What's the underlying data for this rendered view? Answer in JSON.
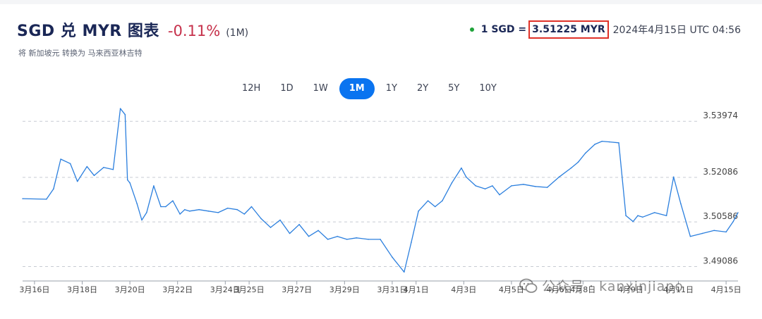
{
  "header": {
    "title": "SGD 兑 MYR 图表",
    "change": "-0.11%",
    "period": "(1M)",
    "subtitle": "将 新加坡元 转换为 马来西亚林吉特"
  },
  "rate": {
    "prefix": "1 SGD =",
    "value": "3.51225 MYR",
    "time": "2024年4月15日 UTC 04:56"
  },
  "tabs": [
    {
      "label": "12H",
      "active": false
    },
    {
      "label": "1D",
      "active": false
    },
    {
      "label": "1W",
      "active": false
    },
    {
      "label": "1M",
      "active": true
    },
    {
      "label": "1Y",
      "active": false
    },
    {
      "label": "2Y",
      "active": false
    },
    {
      "label": "5Y",
      "active": false
    },
    {
      "label": "10Y",
      "active": false
    }
  ],
  "colors": {
    "line": "#2b7fde",
    "accent": "#0a74f0",
    "negative": "#c6314b",
    "highlight": "#e03128"
  },
  "watermark": {
    "text": "公众号 · kanxinjiapo",
    "icon": "wechat-icon"
  },
  "chart_data": {
    "type": "line",
    "title": "",
    "xlabel": "",
    "ylabel": "",
    "ylim": [
      3.486,
      3.545
    ],
    "grid": true,
    "y_ticks": [
      3.53974,
      3.52086,
      3.50586,
      3.49086
    ],
    "y_tick_labels": [
      "3.53974",
      "3.52086",
      "3.50586",
      "3.49086"
    ],
    "x_ticks": [
      0.5,
      2.5,
      4.5,
      6.5,
      8.5,
      9.5,
      11.5,
      13.5,
      15.5,
      16.5,
      18.5,
      20.5,
      22.5,
      23.5,
      25.5,
      27.5,
      29.5
    ],
    "x_tick_labels": [
      "3月16日",
      "3月18日",
      "3月20日",
      "3月22日",
      "3月24日",
      "3月25日",
      "3月27日",
      "3月29日",
      "3月31日",
      "4月1日",
      "4月3日",
      "4月5日",
      "4月6日",
      "4月8日",
      "4月9日",
      "4月11日",
      "4月15日"
    ],
    "x": [
      0.0,
      1.0,
      1.3,
      1.6,
      2.0,
      2.3,
      2.7,
      3.0,
      3.4,
      3.8,
      4.1,
      4.3,
      4.4,
      4.5,
      4.8,
      5.0,
      5.2,
      5.5,
      5.8,
      6.0,
      6.3,
      6.6,
      6.8,
      7.0,
      7.4,
      7.8,
      8.2,
      8.6,
      9.0,
      9.3,
      9.6,
      10.0,
      10.4,
      10.8,
      11.2,
      11.6,
      12.0,
      12.4,
      12.8,
      13.2,
      13.6,
      14.0,
      14.5,
      15.0,
      15.5,
      16.0,
      16.3,
      16.6,
      17.0,
      17.3,
      17.6,
      18.0,
      18.4,
      18.6,
      19.0,
      19.4,
      19.7,
      20.0,
      20.5,
      21.0,
      21.5,
      22.0,
      22.5,
      23.0,
      23.3,
      23.6,
      24.0,
      24.3,
      24.6,
      25.0,
      25.3,
      25.6,
      25.8,
      26.0,
      26.5,
      27.0,
      27.3,
      27.6,
      28.0,
      28.5,
      29.0,
      29.5,
      29.8,
      30.0
    ],
    "values": [
      3.5137,
      3.5135,
      3.517,
      3.527,
      3.5255,
      3.5195,
      3.5245,
      3.5215,
      3.5242,
      3.5235,
      3.544,
      3.542,
      3.52,
      3.519,
      3.512,
      3.5065,
      3.509,
      3.518,
      3.511,
      3.511,
      3.513,
      3.5085,
      3.51,
      3.5095,
      3.51,
      3.5095,
      3.509,
      3.5105,
      3.51,
      3.5085,
      3.511,
      3.507,
      3.504,
      3.5065,
      3.502,
      3.505,
      3.501,
      3.503,
      3.5,
      3.501,
      3.5,
      3.5005,
      3.5,
      3.5,
      3.494,
      3.489,
      3.499,
      3.5095,
      3.513,
      3.511,
      3.513,
      3.519,
      3.524,
      3.521,
      3.518,
      3.517,
      3.518,
      3.515,
      3.518,
      3.5185,
      3.5178,
      3.5175,
      3.521,
      3.524,
      3.526,
      3.529,
      3.532,
      3.533,
      3.5328,
      3.5325,
      3.508,
      3.506,
      3.508,
      3.5075,
      3.509,
      3.508,
      3.521,
      3.512,
      3.501,
      3.502,
      3.503,
      3.5025,
      3.506,
      3.509
    ]
  }
}
